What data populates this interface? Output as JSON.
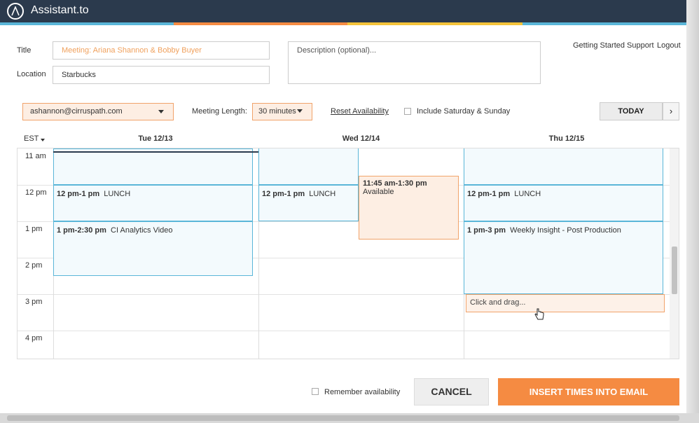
{
  "app": {
    "name": "Assistant.to"
  },
  "colors": {
    "header": "#2b3a4d",
    "stripe": [
      "#f58b42",
      "#f0a15d",
      "#f4c33a",
      "#5ab6d8"
    ],
    "accent": "#f58b42",
    "event_border": "#5ab6d8"
  },
  "top_links": [
    "Getting Started",
    "Support",
    "Logout"
  ],
  "form": {
    "title_label": "Title",
    "title_value": "Meeting: Ariana Shannon & Bobby Buyer",
    "location_label": "Location",
    "location_value": "Starbucks",
    "description_placeholder": "Description (optional)..."
  },
  "controls": {
    "email": "ashannon@cirruspath.com",
    "meeting_length_label": "Meeting Length:",
    "meeting_length_value": "30 minutes",
    "reset_label": "Reset Availability",
    "weekend_label": "Include Saturday & Sunday",
    "today_label": "TODAY",
    "next_icon": "chevron-right-icon"
  },
  "calendar": {
    "timezone": "EST",
    "days": [
      "Tue 12/13",
      "Wed 12/14",
      "Thu 12/15"
    ],
    "hours": [
      "11 am",
      "12 pm",
      "1 pm",
      "2 pm",
      "3 pm",
      "4 pm"
    ],
    "events": [
      {
        "day": "Tue 12/13",
        "time": "12 pm-1 pm",
        "title": "LUNCH"
      },
      {
        "day": "Tue 12/13",
        "time": "1 pm-2:30 pm",
        "title": "CI Analytics Video"
      },
      {
        "day": "Wed 12/14",
        "time": "12 pm-1 pm",
        "title": "LUNCH"
      },
      {
        "day": "Thu 12/15",
        "time": "12 pm-1 pm",
        "title": "LUNCH"
      },
      {
        "day": "Thu 12/15",
        "time": "1 pm-3 pm",
        "title": "Weekly Insight - Post Production"
      }
    ],
    "availability": {
      "day": "Wed 12/14",
      "time": "11:45 am-1:30 pm",
      "label": "Available"
    },
    "drag_hint": "Click and drag..."
  },
  "footer": {
    "remember_label": "Remember availability",
    "cancel_label": "CANCEL",
    "insert_label": "INSERT TIMES INTO EMAIL"
  }
}
